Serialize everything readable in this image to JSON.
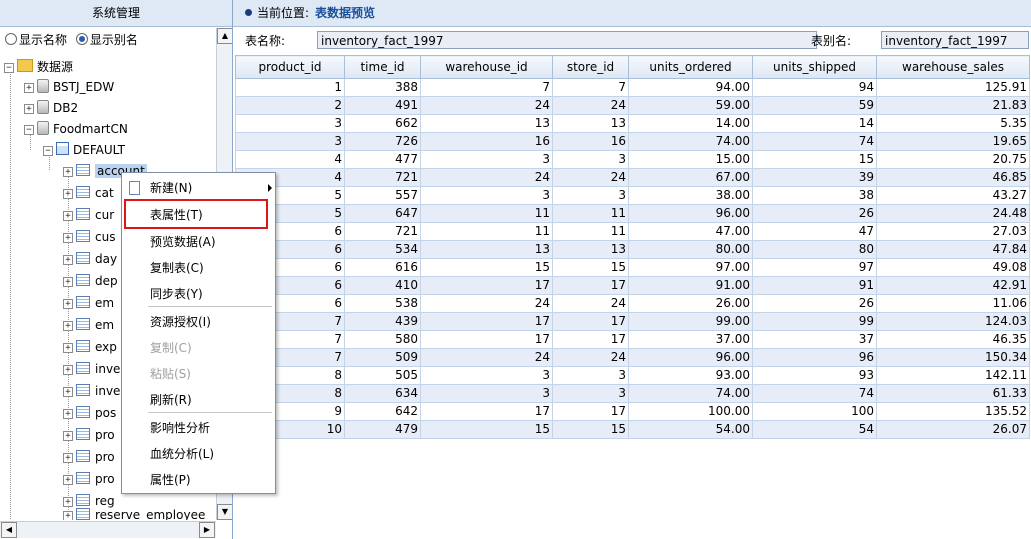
{
  "left_panel": {
    "title": "系统管理",
    "display_options": [
      {
        "label": "显示名称",
        "selected": false
      },
      {
        "label": "显示别名",
        "selected": true
      }
    ],
    "tree": {
      "root_label": "数据源",
      "datasources": [
        "BSTJ_EDW",
        "DB2",
        "FoodmartCN"
      ],
      "schema": "DEFAULT",
      "tables": [
        "account",
        "cat",
        "cur",
        "cus",
        "day",
        "dep",
        "em",
        "em",
        "exp",
        "inve",
        "inve",
        "pos",
        "pro",
        "pro",
        "pro",
        "reg",
        "reserve_employee"
      ]
    }
  },
  "breadcrumb": {
    "prefix": "当前位置:",
    "current": "表数据预览"
  },
  "name_bar": {
    "table_name_label": "表名称:",
    "table_name_value": "inventory_fact_1997",
    "alias_label": "表别名:",
    "alias_value": "inventory_fact_1997"
  },
  "grid": {
    "columns": [
      "product_id",
      "time_id",
      "warehouse_id",
      "store_id",
      "units_ordered",
      "units_shipped",
      "warehouse_sales"
    ],
    "rows": [
      [
        "1",
        "388",
        "7",
        "7",
        "94.00",
        "94",
        "125.91"
      ],
      [
        "2",
        "491",
        "24",
        "24",
        "59.00",
        "59",
        "21.83"
      ],
      [
        "3",
        "662",
        "13",
        "13",
        "14.00",
        "14",
        "5.35"
      ],
      [
        "3",
        "726",
        "16",
        "16",
        "74.00",
        "74",
        "19.65"
      ],
      [
        "4",
        "477",
        "3",
        "3",
        "15.00",
        "15",
        "20.75"
      ],
      [
        "4",
        "721",
        "24",
        "24",
        "67.00",
        "39",
        "46.85"
      ],
      [
        "5",
        "557",
        "3",
        "3",
        "38.00",
        "38",
        "43.27"
      ],
      [
        "5",
        "647",
        "11",
        "11",
        "96.00",
        "26",
        "24.48"
      ],
      [
        "6",
        "721",
        "11",
        "11",
        "47.00",
        "47",
        "27.03"
      ],
      [
        "6",
        "534",
        "13",
        "13",
        "80.00",
        "80",
        "47.84"
      ],
      [
        "6",
        "616",
        "15",
        "15",
        "97.00",
        "97",
        "49.08"
      ],
      [
        "6",
        "410",
        "17",
        "17",
        "91.00",
        "91",
        "42.91"
      ],
      [
        "6",
        "538",
        "24",
        "24",
        "26.00",
        "26",
        "11.06"
      ],
      [
        "7",
        "439",
        "17",
        "17",
        "99.00",
        "99",
        "124.03"
      ],
      [
        "7",
        "580",
        "17",
        "17",
        "37.00",
        "37",
        "46.35"
      ],
      [
        "7",
        "509",
        "24",
        "24",
        "96.00",
        "96",
        "150.34"
      ],
      [
        "8",
        "505",
        "3",
        "3",
        "93.00",
        "93",
        "142.11"
      ],
      [
        "8",
        "634",
        "3",
        "3",
        "74.00",
        "74",
        "61.33"
      ],
      [
        "9",
        "642",
        "17",
        "17",
        "100.00",
        "100",
        "135.52"
      ],
      [
        "10",
        "479",
        "15",
        "15",
        "54.00",
        "54",
        "26.07"
      ]
    ]
  },
  "context_menu": {
    "items": [
      {
        "label": "新建(N)",
        "enabled": true,
        "submenu": true
      },
      {
        "label": "表属性(T)",
        "enabled": true,
        "highlighted": true
      },
      {
        "label": "预览数据(A)",
        "enabled": true
      },
      {
        "label": "复制表(C)",
        "enabled": true
      },
      {
        "label": "同步表(Y)",
        "enabled": true
      },
      {
        "label": "资源授权(I)",
        "enabled": true
      },
      {
        "label": "复制(C)",
        "enabled": false
      },
      {
        "label": "粘贴(S)",
        "enabled": false
      },
      {
        "label": "刷新(R)",
        "enabled": true
      },
      {
        "label": "影响性分析",
        "enabled": true
      },
      {
        "label": "血统分析(L)",
        "enabled": true
      },
      {
        "label": "属性(P)",
        "enabled": true
      }
    ],
    "highlight_color": "#e0141b"
  }
}
